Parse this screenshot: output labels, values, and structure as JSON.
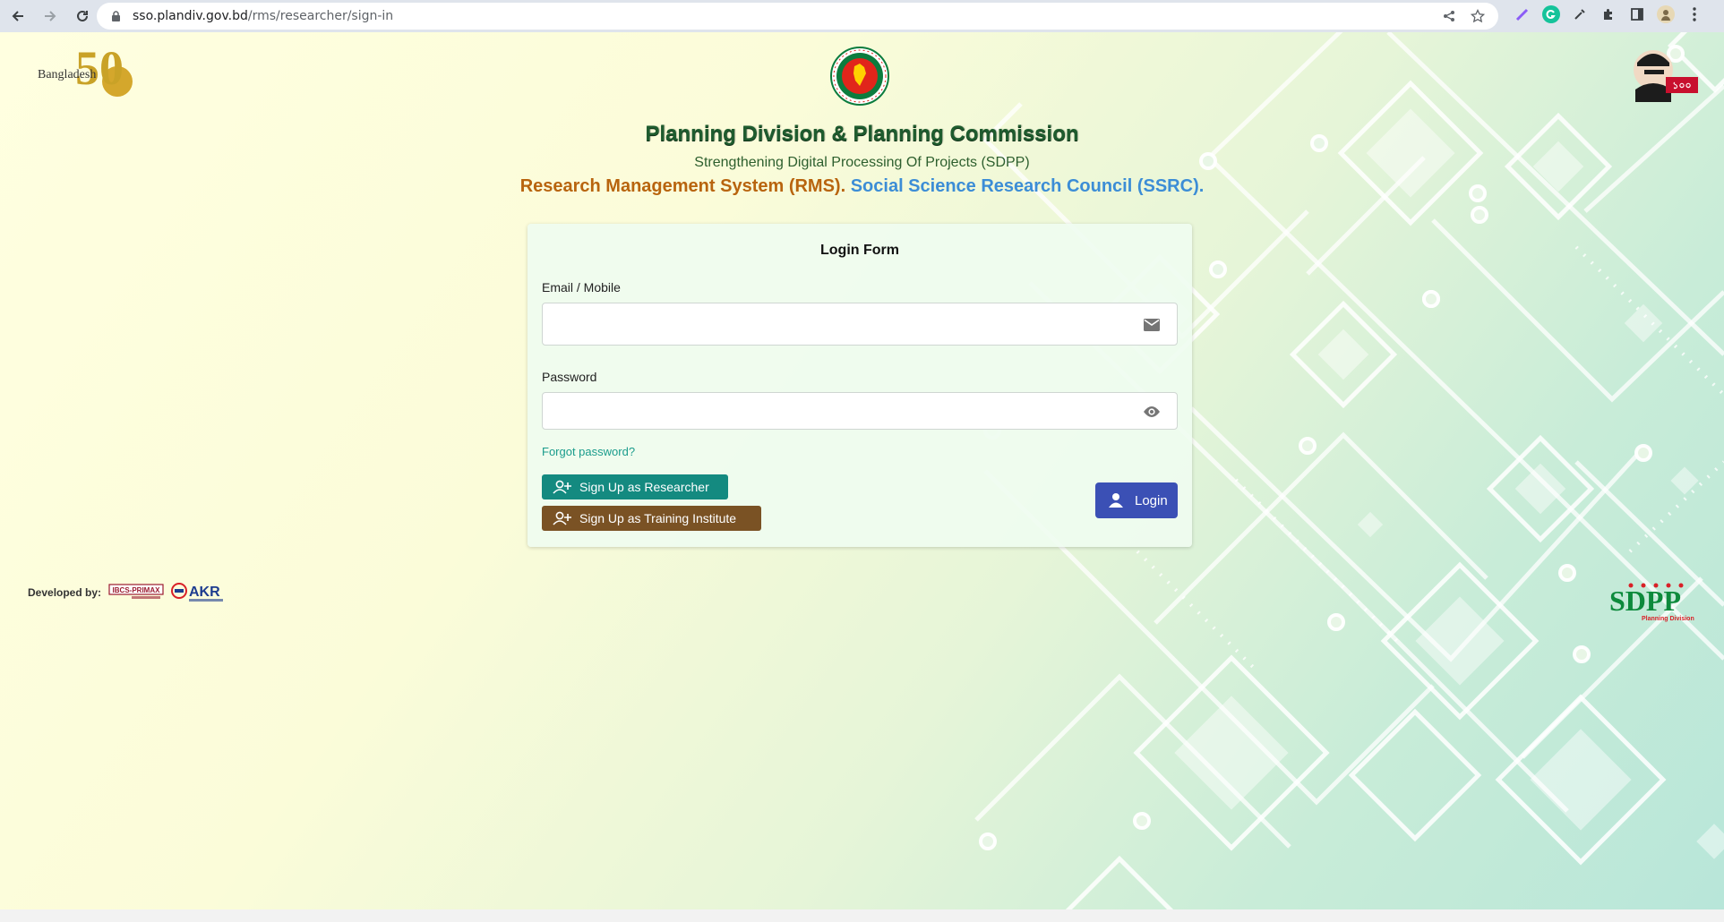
{
  "browser": {
    "url_host": "sso.plandiv.gov.bd",
    "url_path": "/rms/researcher/sign-in"
  },
  "header": {
    "org_title": "Planning Division & Planning Commission",
    "project_subtitle": "Strengthening Digital Processing Of Projects (SDPP)",
    "system_name": "Research Management System (RMS).",
    "council_name": "Social Science Research Council (SSRC)."
  },
  "logos": {
    "bangladesh50_text": "Bangladesh",
    "bangladesh50_number": "50",
    "sdpp_text": "SDPP",
    "sdpp_sub": "Planning Division"
  },
  "login_form": {
    "title": "Login Form",
    "email_label": "Email / Mobile",
    "email_value": "",
    "password_label": "Password",
    "password_value": "",
    "forgot_password": "Forgot password?",
    "signup_researcher": "Sign Up as Researcher",
    "signup_institute": "Sign Up as Training Institute",
    "login_button": "Login"
  },
  "footer": {
    "developed_by": "Developed by:",
    "dev_logo_1": "IBCS-PRIMAX",
    "dev_logo_2": "AKR"
  },
  "colors": {
    "title_green": "#1e5c2e",
    "rms_orange": "#b8640e",
    "ssrc_blue": "#3c8dd6",
    "researcher_btn": "#148a80",
    "institute_btn": "#7a5224",
    "login_btn": "#3b50b5",
    "forgot_link": "#1a9c8c"
  },
  "icons": {
    "email_field": "mail-icon",
    "password_field": "eye-icon",
    "signup": "person-add-icon",
    "login": "person-icon"
  }
}
